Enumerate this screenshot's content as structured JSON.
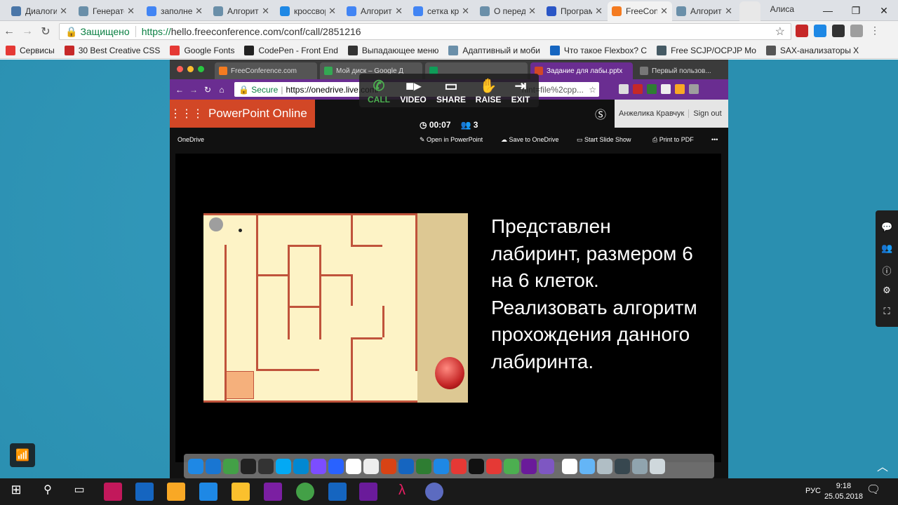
{
  "browser": {
    "tabs": [
      {
        "title": "Диалоги",
        "favicon": "vk-icon",
        "color": "#4a76a8"
      },
      {
        "title": "Генератор",
        "favicon": "habr-icon",
        "color": "#6a8fa9"
      },
      {
        "title": "заполнение",
        "favicon": "google-icon",
        "color": "#4285f4"
      },
      {
        "title": "Алгоритм",
        "favicon": "habr-icon",
        "color": "#6a8fa9"
      },
      {
        "title": "кроссворд",
        "favicon": "share-icon",
        "color": "#1e88e5"
      },
      {
        "title": "Алгоритм",
        "favicon": "google-icon",
        "color": "#4285f4"
      },
      {
        "title": "сетка кр",
        "favicon": "google-icon",
        "color": "#4285f4"
      },
      {
        "title": "О перед",
        "favicon": "habr-icon",
        "color": "#6a8fa9"
      },
      {
        "title": "Програм",
        "favicon": "bold-k-icon",
        "color": "#2a56c6"
      },
      {
        "title": "FreeCon",
        "favicon": "freeconference-icon",
        "color": "#f47b20",
        "active": true
      },
      {
        "title": "Алгорит",
        "favicon": "habr-icon",
        "color": "#6a8fa9"
      }
    ],
    "user": "Алиса",
    "address": {
      "secure_label": "Защищено",
      "scheme": "https://",
      "host_path": "hello.freeconference.com/conf/call/2851216"
    },
    "bookmarks": [
      {
        "label": "Сервисы",
        "color": "#e53935"
      },
      {
        "label": "30 Best Creative CSS",
        "color": "#c62828"
      },
      {
        "label": "Google Fonts",
        "color": "#e53935"
      },
      {
        "label": "CodePen - Front End",
        "color": "#222222"
      },
      {
        "label": "Выпадающее меню",
        "color": "#333333"
      },
      {
        "label": "Адаптивный и моби",
        "color": "#6a8fa9"
      },
      {
        "label": "Что такое Flexbox? С",
        "color": "#1565c0"
      },
      {
        "label": "Free SCJP/OCPJP Mo",
        "color": "#455a64"
      },
      {
        "label": "SAX-анализаторы X",
        "color": "#555555"
      }
    ]
  },
  "remote": {
    "tabs": [
      {
        "title": "FreeConference.com",
        "color": "#f47b20"
      },
      {
        "title": "Мой диск – Google Д",
        "color": "#34a853"
      },
      {
        "title": "",
        "color": "#0f9d58"
      },
      {
        "title": "Задание для лабы.pptx",
        "color": "#d24726"
      },
      {
        "title": "Первый пользов...",
        "color": "#777777"
      }
    ],
    "address": {
      "secure_label": "Secure",
      "url": "https://onedrive.live.com/",
      "tail": "hint=file%2cpp..."
    },
    "callbar": {
      "call": "CALL",
      "video": "VIDEO",
      "share": "SHARE",
      "raise": "RAISE",
      "exit": "EXIT"
    },
    "timer": "00:07",
    "participants": "3",
    "app_name": "PowerPoint Online",
    "account_name": "Анжелика Кравчук",
    "sign_out": "Sign out",
    "onedrive": "OneDrive",
    "commands": {
      "open": "Open in PowerPoint",
      "save": "Save to OneDrive",
      "slideshow": "Start Slide Show",
      "print": "Print to PDF",
      "more": "•••"
    },
    "slide_text": "Представлен лабиринт, размером 6 на 6 клеток. Реализовать алгоритм прохождения данного лабиринта."
  },
  "taskbar": {
    "lang": "РУС",
    "time": "9:18",
    "date": "25.05.2018",
    "notifications": "1"
  },
  "colors": {
    "accent_powerpoint": "#d24726",
    "remote_toolbar": "#6a2d91",
    "call_green": "#4caf50",
    "maze_wall": "#c0533b",
    "maze_floor": "#fdf3c6"
  }
}
